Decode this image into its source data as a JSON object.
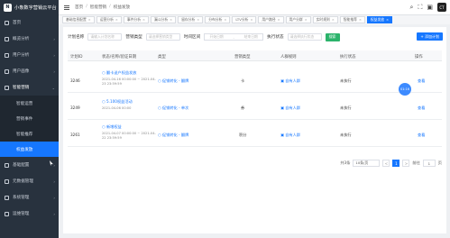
{
  "app": {
    "title": "小象数字营销云平台",
    "logo_text": "N"
  },
  "sidebar": {
    "items": [
      {
        "label": "首页"
      },
      {
        "label": "概览分析"
      },
      {
        "label": "用户分析"
      },
      {
        "label": "用户画像"
      },
      {
        "label": "智能营销",
        "expanded": true,
        "children": [
          {
            "label": "智能运营"
          },
          {
            "label": "营销事件"
          },
          {
            "label": "智能推荐"
          },
          {
            "label": "权益发放",
            "active": true
          }
        ]
      },
      {
        "label": "基础配置"
      },
      {
        "label": "元数据管理"
      },
      {
        "label": "系统管理"
      },
      {
        "label": "运维管理"
      }
    ]
  },
  "topbar": {
    "breadcrumb": [
      "首页",
      "智能营销",
      "权益发放"
    ],
    "icons": [
      "search-icon",
      "fullscreen-icon",
      "notification-icon"
    ],
    "avatar_text": "CT"
  },
  "tabs": [
    {
      "label": "基础信息配置"
    },
    {
      "label": "运营分析"
    },
    {
      "label": "事件分析"
    },
    {
      "label": "漏斗分析"
    },
    {
      "label": "留存分析"
    },
    {
      "label": "分布分析"
    },
    {
      "label": "LTV分析"
    },
    {
      "label": "用户路径"
    },
    {
      "label": "用户分群"
    },
    {
      "label": "实时规则"
    },
    {
      "label": "智能推荐"
    },
    {
      "label": "权益发放",
      "active": true
    }
  ],
  "filters": {
    "plan_name_label": "计划名称",
    "plan_name_placeholder": "请输入计划名称",
    "campaign_type_label": "营销类型",
    "campaign_type_placeholder": "请选择营销类型",
    "time_range_label": "时间区间",
    "start_placeholder": "开始日期",
    "range_sep": "-",
    "end_placeholder": "结束日期",
    "status_label": "执行状态",
    "status_placeholder": "请选择执行状态",
    "search_button": "搜索",
    "add_button": "+ 添加计划"
  },
  "table": {
    "headers": [
      "计划ID",
      "状态/名称/验证日期",
      "类型",
      "营销类型",
      "人群规则",
      "执行状态",
      "操作"
    ],
    "rows": [
      {
        "id": "3246",
        "name": "○ 翻卡送户权益发放",
        "date": "2021-04-16 00:00:00 ~ 2021-04-23 23:59:59",
        "type": "○ 促销转化 - 翻牌",
        "campaign": "卡",
        "crowd": "▣ 自有人群",
        "status": "未执行",
        "action": "查看"
      },
      {
        "id": "3249",
        "name": "○ 5.100权益活动",
        "date": "2021-04-06 00:00",
        "type": "○ 促销转化 - 单次",
        "campaign": "券",
        "crowd": "▣ 自有人群",
        "status": "未执行",
        "action": "查看"
      },
      {
        "id": "3261",
        "name": "○ 新增权益",
        "date": "2021-04-07 00:00:00 ~ 2021-04-22 23:59:59",
        "type": "○ 促销转化 - 翻牌",
        "campaign": "积分",
        "crowd": "▣ 自有人群",
        "status": "未执行",
        "action": "查看"
      }
    ],
    "bubble_text": "01:16"
  },
  "pagination": {
    "total": "共3条",
    "page_size": "10条/页",
    "prev": "<",
    "current": "1",
    "next": ">",
    "goto_label": "前往",
    "goto_value": "1",
    "page_suffix": "页"
  }
}
